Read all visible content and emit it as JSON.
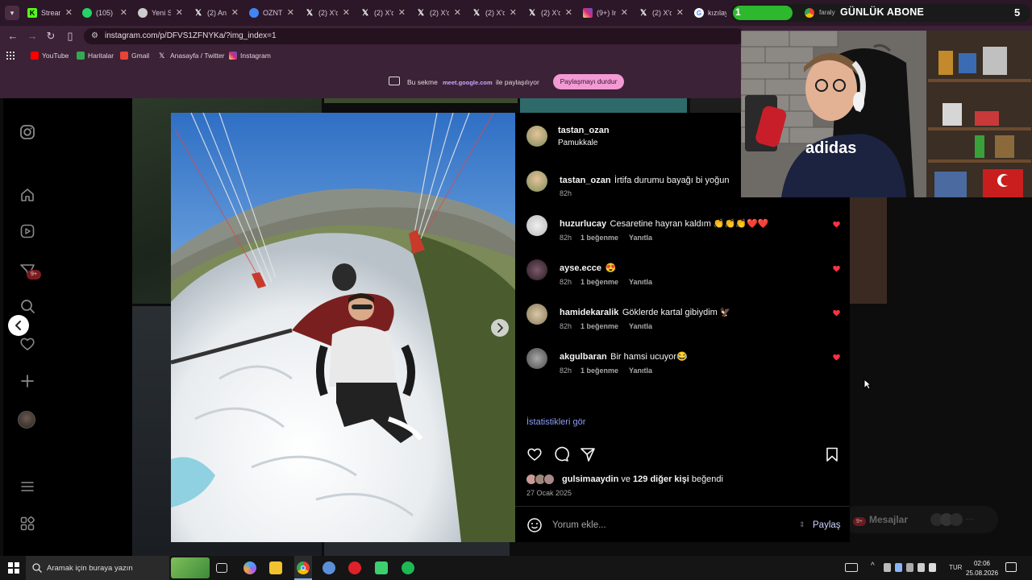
{
  "browser": {
    "tabs": [
      {
        "label": "Stream",
        "icon": "kick-icon",
        "color": "#53fc18"
      },
      {
        "label": "(105)",
        "icon": "whatsapp-icon",
        "color": "#25d366"
      },
      {
        "label": "Yeni S",
        "icon": "chrome-icon",
        "color": "#cccccc"
      },
      {
        "label": "(2) An",
        "icon": "x-icon",
        "color": "#ffffff"
      },
      {
        "label": "OZNT",
        "icon": "chrome-icon",
        "color": "#4285f4"
      },
      {
        "label": "(2) X'd",
        "icon": "x-icon",
        "color": "#ffffff"
      },
      {
        "label": "(2) X'd",
        "icon": "x-icon",
        "color": "#ffffff"
      },
      {
        "label": "(2) X'd",
        "icon": "x-icon",
        "color": "#ffffff"
      },
      {
        "label": "(2) X'd",
        "icon": "x-icon",
        "color": "#ffffff"
      },
      {
        "label": "(2) X'd",
        "icon": "x-icon",
        "color": "#ffffff"
      },
      {
        "label": "(9+) In",
        "icon": "instagram-icon",
        "color": "#e1306c"
      },
      {
        "label": "(2) X'd",
        "icon": "x-icon",
        "color": "#ffffff"
      },
      {
        "label": "kızılay",
        "icon": "google-icon",
        "color": "#ffffff"
      }
    ],
    "url": "instagram.com/p/DFVS1ZFNYKa/?img_index=1",
    "bookmarks": [
      {
        "label": "YouTube",
        "color": "#ff0000"
      },
      {
        "label": "Haritalar",
        "color": "#34a853"
      },
      {
        "label": "Gmail",
        "color": "#ea4335"
      },
      {
        "label": "Anasayfa / Twitter",
        "color": "#ffffff"
      },
      {
        "label": "Instagram",
        "color": "#e1306c"
      }
    ],
    "share_bar": {
      "prefix": "Bu sekme",
      "domain": "meet.google.com",
      "suffix": "ile paylaşılıyor",
      "stop_button": "Paylaşmayı durdur"
    }
  },
  "overlay": {
    "abone_count": "1",
    "abone_label": "GÜNLÜK ABONE",
    "abone_right": "5",
    "tab_partial": "faraly"
  },
  "sidenav": {
    "notification_badge": "9+",
    "items": [
      "instagram-logo-icon",
      "home-icon",
      "reels-icon",
      "messages-icon",
      "search-icon",
      "heart-icon",
      "create-icon",
      "profile-avatar",
      "menu-icon",
      "more-icon"
    ]
  },
  "post": {
    "author": "tastan_ozan",
    "location": "Pamukkale",
    "caption": {
      "user": "tastan_ozan",
      "text": "İrtifa durumu bayağı bi yoğun",
      "time": "82h"
    },
    "comments": [
      {
        "user": "huzurlucay",
        "text": "Cesaretine hayran kaldım 👏👏👏❤️❤️",
        "time": "82h",
        "likes": "1 beğenme",
        "reply": "Yanıtla"
      },
      {
        "user": "ayse.ecce",
        "text": "😍",
        "time": "82h",
        "likes": "1 beğenme",
        "reply": "Yanıtla"
      },
      {
        "user": "hamidekaralik",
        "text": "Göklerde kartal gibiydim 🦅",
        "time": "82h",
        "likes": "1 beğenme",
        "reply": "Yanıtla"
      },
      {
        "user": "akgulbaran",
        "text": "Bir hamsi ucuyor😂",
        "time": "82h",
        "likes": "1 beğenme",
        "reply": "Yanıtla"
      }
    ],
    "stats_link": "İstatistikleri gör",
    "liked_by": {
      "user": "gulsimaaydin",
      "middle": "ve",
      "others": "129 diğer kişi",
      "suffix": "beğendi"
    },
    "date": "27 Ocak 2025",
    "comment_placeholder": "Yorum ekle...",
    "share_button": "Paylaş"
  },
  "messages_pill": {
    "label": "Mesajlar",
    "badge": "9+"
  },
  "taskbar": {
    "search_placeholder": "Aramak için buraya yazın",
    "lang": "TUR",
    "time": "02:06",
    "date": "25.08.2026"
  },
  "colors": {
    "accent_link": "#8e9cf6",
    "heart_red": "#ff3040",
    "share_pink": "#f29ad3",
    "browser_frame": "#3b2236"
  }
}
